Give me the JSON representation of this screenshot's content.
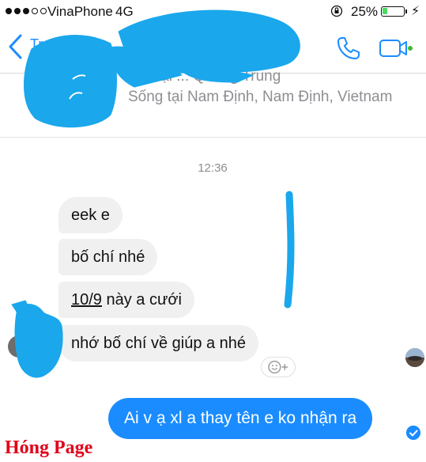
{
  "status_bar": {
    "carrier": "VinaPhone",
    "network": "4G",
    "battery_percent": "25%",
    "battery_level": 0.25,
    "icons": [
      "signal-dots-icon",
      "orientation-lock-icon",
      "battery-icon",
      "charging-bolt-icon"
    ]
  },
  "header": {
    "back_text": "Tr",
    "icons": [
      "back-chevron-icon",
      "phone-icon",
      "video-camera-icon"
    ],
    "accent_color": "#1a8cff"
  },
  "profile": {
    "line1": "học tại ... Quang Trung",
    "line2": "Sống tại Nam Định, Nam Định, Vietnam"
  },
  "conversation": {
    "timestamp": "12:36",
    "incoming": [
      {
        "text": "eek e"
      },
      {
        "text": "bố chí nhé"
      },
      {
        "text_underlined": "10/9",
        "text_rest": " này a cưới"
      },
      {
        "text": "nhớ bố chí về giúp a nhé"
      }
    ],
    "outgoing": [
      {
        "text": "Ai v ạ xl a thay tên e ko nhận ra"
      }
    ],
    "bubble_colors": {
      "incoming": "#f1f0f0",
      "outgoing": "#1a8cff"
    }
  },
  "watermark": "Hóng Page"
}
